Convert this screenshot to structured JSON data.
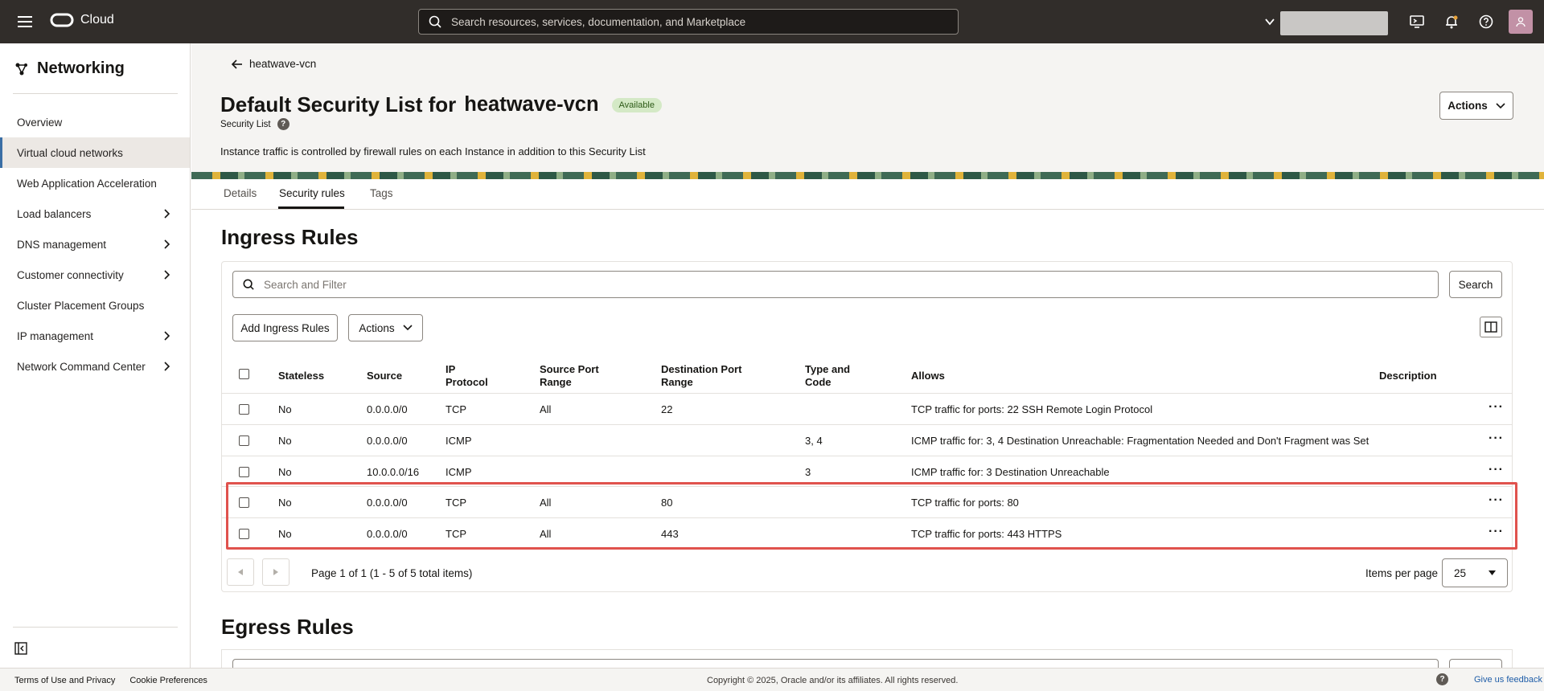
{
  "topbar": {
    "brand": "Cloud",
    "search_placeholder": "Search resources, services, documentation, and Marketplace"
  },
  "sidebar": {
    "title": "Networking",
    "items": [
      {
        "label": "Overview",
        "chevron": false,
        "active": false
      },
      {
        "label": "Virtual cloud networks",
        "chevron": false,
        "active": true
      },
      {
        "label": "Web Application Acceleration",
        "chevron": false,
        "active": false
      },
      {
        "label": "Load balancers",
        "chevron": true,
        "active": false
      },
      {
        "label": "DNS management",
        "chevron": true,
        "active": false
      },
      {
        "label": "Customer connectivity",
        "chevron": true,
        "active": false
      },
      {
        "label": "Cluster Placement Groups",
        "chevron": false,
        "active": false
      },
      {
        "label": "IP management",
        "chevron": true,
        "active": false
      },
      {
        "label": "Network Command Center",
        "chevron": true,
        "active": false
      }
    ]
  },
  "header": {
    "back_label": "heatwave-vcn",
    "title": "Default Security List for",
    "vcn_name": "heatwave-vcn",
    "status": "Available",
    "subtitle": "Security List",
    "info": "Instance traffic is controlled by firewall rules on each Instance in addition to this Security List",
    "actions_label": "Actions"
  },
  "tabs": [
    "Details",
    "Security rules",
    "Tags"
  ],
  "ingress": {
    "title": "Ingress Rules",
    "filter_placeholder": "Search and Filter",
    "search_label": "Search",
    "add_label": "Add Ingress Rules",
    "actions_label": "Actions",
    "columns": {
      "stateless": "Stateless",
      "source": "Source",
      "ip_protocol": [
        "IP",
        "Protocol"
      ],
      "source_port": [
        "Source Port",
        "Range"
      ],
      "dest_port": [
        "Destination Port",
        "Range"
      ],
      "type_code": [
        "Type and",
        "Code"
      ],
      "allows": "Allows",
      "description": "Description"
    },
    "rows": [
      {
        "stateless": "No",
        "source": "0.0.0.0/0",
        "protocol": "TCP",
        "source_port": "All",
        "dest_port": "22",
        "type_code": "",
        "allows": "TCP traffic for ports: 22 SSH Remote Login Protocol"
      },
      {
        "stateless": "No",
        "source": "0.0.0.0/0",
        "protocol": "ICMP",
        "source_port": "",
        "dest_port": "",
        "type_code": "3, 4",
        "allows": "ICMP traffic for: 3, 4 Destination Unreachable: Fragmentation Needed and Don't Fragment was Set"
      },
      {
        "stateless": "No",
        "source": "10.0.0.0/16",
        "protocol": "ICMP",
        "source_port": "",
        "dest_port": "",
        "type_code": "3",
        "allows": "ICMP traffic for: 3 Destination Unreachable"
      },
      {
        "stateless": "No",
        "source": "0.0.0.0/0",
        "protocol": "TCP",
        "source_port": "All",
        "dest_port": "80",
        "type_code": "",
        "allows": "TCP traffic for ports: 80"
      },
      {
        "stateless": "No",
        "source": "0.0.0.0/0",
        "protocol": "TCP",
        "source_port": "All",
        "dest_port": "443",
        "type_code": "",
        "allows": "TCP traffic for ports: 443 HTTPS"
      }
    ],
    "page_info": "Page 1 of 1 (1 - 5 of 5 total items)",
    "items_per_page_label": "Items per page",
    "items_per_page_value": "25"
  },
  "egress": {
    "title": "Egress Rules"
  },
  "footer": {
    "terms": "Terms of Use and Privacy",
    "cookies": "Cookie Preferences",
    "copyright": "Copyright © 2025, Oracle and/or its affiliates. All rights reserved.",
    "feedback": "Give us feedback"
  },
  "colors": {
    "highlight": "#e0524d",
    "topbar": "#312d2a",
    "badge": "#d4e9c6",
    "link": "#1f5da8"
  }
}
